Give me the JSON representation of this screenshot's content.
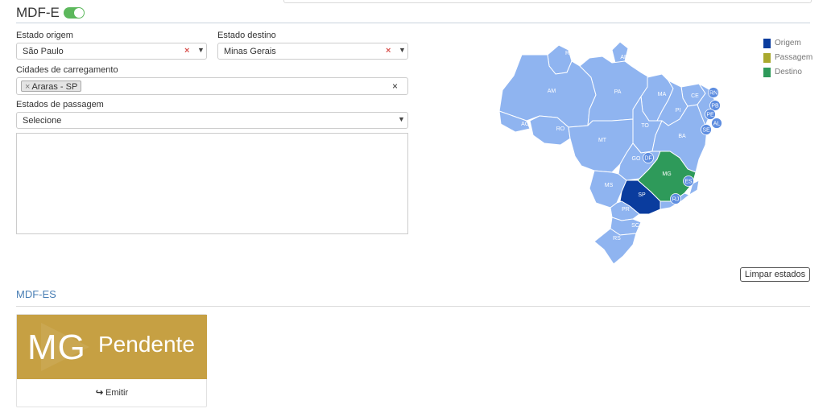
{
  "header": {
    "title": "MDF-E",
    "toggle_on": true
  },
  "form": {
    "origem": {
      "label": "Estado origem",
      "value": "São Paulo",
      "clear": "×",
      "arrow": "▼"
    },
    "destino": {
      "label": "Estado destino",
      "value": "Minas Gerais",
      "clear": "×",
      "arrow": "▼"
    },
    "cidades": {
      "label": "Cidades de carregamento",
      "tag_remove": "×",
      "tag": "Araras - SP",
      "clear": "×"
    },
    "passagem": {
      "label": "Estados de passagem",
      "value": "Selecione",
      "arrow": "▼"
    }
  },
  "map": {
    "legend": [
      {
        "label": "Origem",
        "color": "#0a3c9e"
      },
      {
        "label": "Passagem",
        "color": "#a9a92e"
      },
      {
        "label": "Destino",
        "color": "#2e9a5a"
      }
    ],
    "state_colors": {
      "default": "#8fb4f0",
      "origem": "#0a3c9e",
      "destino": "#2e9a5a",
      "bubble": "#5f8ee0"
    },
    "states": [
      "RR",
      "AP",
      "AM",
      "PA",
      "MA",
      "CE",
      "PI",
      "AC",
      "RO",
      "TO",
      "BA",
      "MT",
      "GO",
      "MG",
      "MS",
      "SP",
      "PR",
      "SC",
      "RS"
    ],
    "bubbles": [
      "RN",
      "PB",
      "PE",
      "AL",
      "SE",
      "DF",
      "ES",
      "RJ"
    ],
    "clear_button": "Limpar estados"
  },
  "mdfes": {
    "section_title": "MDF-ES",
    "card": {
      "uf": "MG",
      "status": "Pendente",
      "action_icon": "↪",
      "action": "Emitir",
      "color": "#c6a043"
    }
  }
}
